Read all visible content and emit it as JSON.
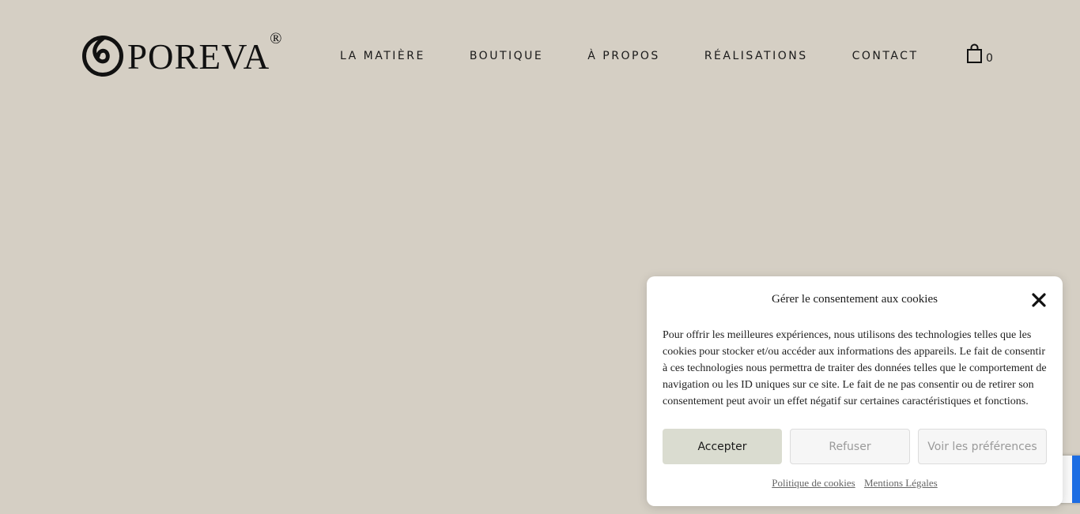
{
  "brand": {
    "name": "POREVA",
    "registered_mark": "®"
  },
  "nav": {
    "items": [
      {
        "label": "LA MATIÈRE"
      },
      {
        "label": "BOUTIQUE"
      },
      {
        "label": "À PROPOS"
      },
      {
        "label": "RÉALISATIONS"
      },
      {
        "label": "CONTACT"
      }
    ]
  },
  "cart": {
    "icon": "shopping-bag-icon",
    "count": "0"
  },
  "cookie_banner": {
    "title": "Gérer le consentement aux cookies",
    "body": "Pour offrir les meilleures expériences, nous utilisons des technologies telles que les cookies pour stocker et/ou accéder aux informations des appareils. Le fait de consentir à ces technologies nous permettra de traiter des données telles que le comportement de navigation ou les ID uniques sur ce site. Le fait de ne pas consentir ou de retirer son consentement peut avoir un effet négatif sur certaines caractéristiques et fonctions.",
    "buttons": {
      "accept": "Accepter",
      "refuse": "Refuser",
      "preferences": "Voir les préférences"
    },
    "links": {
      "cookie_policy": "Politique de cookies",
      "legal": "Mentions Légales"
    },
    "close_icon": "close-icon"
  },
  "colors": {
    "page_background": "#d5cfc4",
    "accept_button": "#dadcd0",
    "recaptcha_blue": "#1c6de3"
  }
}
